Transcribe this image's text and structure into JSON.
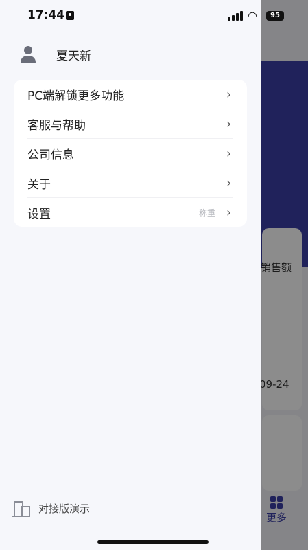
{
  "status_bar": {
    "time": "17:44",
    "battery": "95"
  },
  "drawer": {
    "user": {
      "name": "夏天新",
      "icon": "user-icon"
    },
    "menu": [
      {
        "label": "PC端解锁更多功能",
        "extra": "",
        "icon": "chevron-right-icon"
      },
      {
        "label": "客服与帮助",
        "extra": "",
        "icon": "chevron-right-icon"
      },
      {
        "label": "公司信息",
        "extra": "",
        "icon": "chevron-right-icon"
      },
      {
        "label": "关于",
        "extra": "",
        "icon": "chevron-right-icon"
      },
      {
        "label": "设置",
        "extra": "称重",
        "icon": "chevron-right-icon"
      }
    ],
    "footer": {
      "label": "对接版演示",
      "icon": "building-icon"
    }
  },
  "background": {
    "card_label": "销售额",
    "date_fragment": "09-24",
    "tab_more": "更多",
    "accent_color": "#3b3ea6"
  }
}
